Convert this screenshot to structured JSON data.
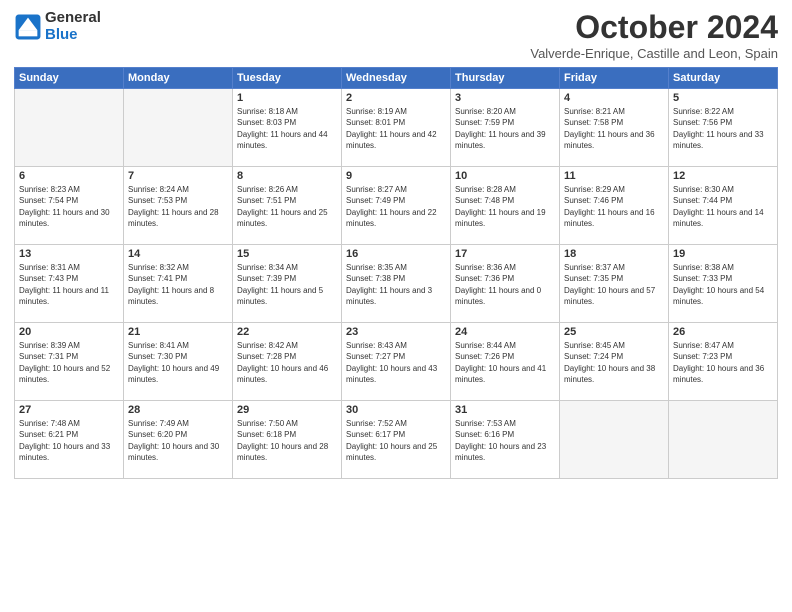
{
  "logo": {
    "general": "General",
    "blue": "Blue"
  },
  "title": "October 2024",
  "location": "Valverde-Enrique, Castille and Leon, Spain",
  "weekdays": [
    "Sunday",
    "Monday",
    "Tuesday",
    "Wednesday",
    "Thursday",
    "Friday",
    "Saturday"
  ],
  "weeks": [
    [
      {
        "day": "",
        "empty": true
      },
      {
        "day": "",
        "empty": true
      },
      {
        "day": "1",
        "sunrise": "8:18 AM",
        "sunset": "8:03 PM",
        "daylight": "11 hours and 44 minutes."
      },
      {
        "day": "2",
        "sunrise": "8:19 AM",
        "sunset": "8:01 PM",
        "daylight": "11 hours and 42 minutes."
      },
      {
        "day": "3",
        "sunrise": "8:20 AM",
        "sunset": "7:59 PM",
        "daylight": "11 hours and 39 minutes."
      },
      {
        "day": "4",
        "sunrise": "8:21 AM",
        "sunset": "7:58 PM",
        "daylight": "11 hours and 36 minutes."
      },
      {
        "day": "5",
        "sunrise": "8:22 AM",
        "sunset": "7:56 PM",
        "daylight": "11 hours and 33 minutes."
      }
    ],
    [
      {
        "day": "6",
        "sunrise": "8:23 AM",
        "sunset": "7:54 PM",
        "daylight": "11 hours and 30 minutes."
      },
      {
        "day": "7",
        "sunrise": "8:24 AM",
        "sunset": "7:53 PM",
        "daylight": "11 hours and 28 minutes."
      },
      {
        "day": "8",
        "sunrise": "8:26 AM",
        "sunset": "7:51 PM",
        "daylight": "11 hours and 25 minutes."
      },
      {
        "day": "9",
        "sunrise": "8:27 AM",
        "sunset": "7:49 PM",
        "daylight": "11 hours and 22 minutes."
      },
      {
        "day": "10",
        "sunrise": "8:28 AM",
        "sunset": "7:48 PM",
        "daylight": "11 hours and 19 minutes."
      },
      {
        "day": "11",
        "sunrise": "8:29 AM",
        "sunset": "7:46 PM",
        "daylight": "11 hours and 16 minutes."
      },
      {
        "day": "12",
        "sunrise": "8:30 AM",
        "sunset": "7:44 PM",
        "daylight": "11 hours and 14 minutes."
      }
    ],
    [
      {
        "day": "13",
        "sunrise": "8:31 AM",
        "sunset": "7:43 PM",
        "daylight": "11 hours and 11 minutes."
      },
      {
        "day": "14",
        "sunrise": "8:32 AM",
        "sunset": "7:41 PM",
        "daylight": "11 hours and 8 minutes."
      },
      {
        "day": "15",
        "sunrise": "8:34 AM",
        "sunset": "7:39 PM",
        "daylight": "11 hours and 5 minutes."
      },
      {
        "day": "16",
        "sunrise": "8:35 AM",
        "sunset": "7:38 PM",
        "daylight": "11 hours and 3 minutes."
      },
      {
        "day": "17",
        "sunrise": "8:36 AM",
        "sunset": "7:36 PM",
        "daylight": "11 hours and 0 minutes."
      },
      {
        "day": "18",
        "sunrise": "8:37 AM",
        "sunset": "7:35 PM",
        "daylight": "10 hours and 57 minutes."
      },
      {
        "day": "19",
        "sunrise": "8:38 AM",
        "sunset": "7:33 PM",
        "daylight": "10 hours and 54 minutes."
      }
    ],
    [
      {
        "day": "20",
        "sunrise": "8:39 AM",
        "sunset": "7:31 PM",
        "daylight": "10 hours and 52 minutes."
      },
      {
        "day": "21",
        "sunrise": "8:41 AM",
        "sunset": "7:30 PM",
        "daylight": "10 hours and 49 minutes."
      },
      {
        "day": "22",
        "sunrise": "8:42 AM",
        "sunset": "7:28 PM",
        "daylight": "10 hours and 46 minutes."
      },
      {
        "day": "23",
        "sunrise": "8:43 AM",
        "sunset": "7:27 PM",
        "daylight": "10 hours and 43 minutes."
      },
      {
        "day": "24",
        "sunrise": "8:44 AM",
        "sunset": "7:26 PM",
        "daylight": "10 hours and 41 minutes."
      },
      {
        "day": "25",
        "sunrise": "8:45 AM",
        "sunset": "7:24 PM",
        "daylight": "10 hours and 38 minutes."
      },
      {
        "day": "26",
        "sunrise": "8:47 AM",
        "sunset": "7:23 PM",
        "daylight": "10 hours and 36 minutes."
      }
    ],
    [
      {
        "day": "27",
        "sunrise": "7:48 AM",
        "sunset": "6:21 PM",
        "daylight": "10 hours and 33 minutes."
      },
      {
        "day": "28",
        "sunrise": "7:49 AM",
        "sunset": "6:20 PM",
        "daylight": "10 hours and 30 minutes."
      },
      {
        "day": "29",
        "sunrise": "7:50 AM",
        "sunset": "6:18 PM",
        "daylight": "10 hours and 28 minutes."
      },
      {
        "day": "30",
        "sunrise": "7:52 AM",
        "sunset": "6:17 PM",
        "daylight": "10 hours and 25 minutes."
      },
      {
        "day": "31",
        "sunrise": "7:53 AM",
        "sunset": "6:16 PM",
        "daylight": "10 hours and 23 minutes."
      },
      {
        "day": "",
        "empty": true
      },
      {
        "day": "",
        "empty": true
      }
    ]
  ]
}
